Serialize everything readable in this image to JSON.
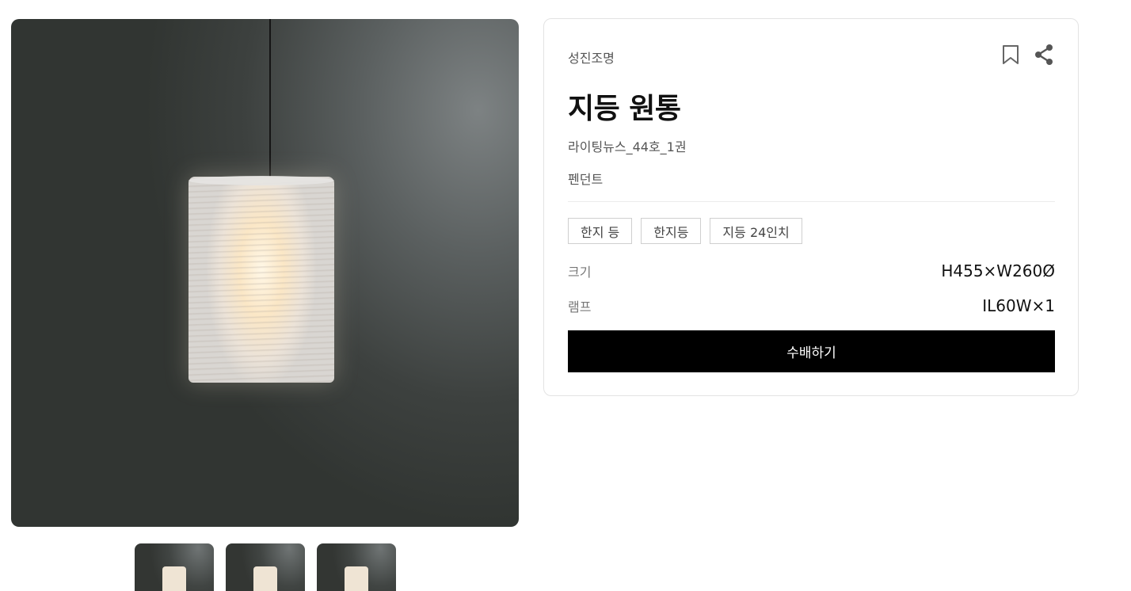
{
  "product": {
    "brand": "성진조명",
    "title": "지등 원통",
    "publication": "라이팅뉴스_44호_1권",
    "category": "펜던트",
    "tags": [
      "한지 등",
      "한지등",
      "지등 24인치"
    ],
    "specs": {
      "size": {
        "label": "크기",
        "value": "H455×W260Ø"
      },
      "lamp": {
        "label": "램프",
        "value": "IL60W×1"
      }
    },
    "order_label": "수배하기"
  },
  "icons": {
    "bookmark": "bookmark-icon",
    "share": "share-icon"
  },
  "colors": {
    "button_bg": "#000000",
    "icon": "#666666"
  },
  "gallery": {
    "thumbnail_count": 3
  }
}
